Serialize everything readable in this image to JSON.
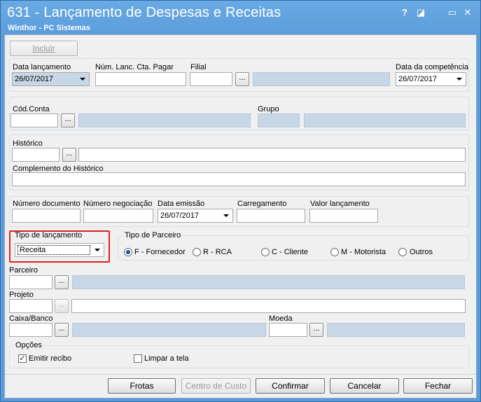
{
  "window": {
    "title": "631 - Lançamento de Despesas e Receitas",
    "subtitle": "Winthor - PC Sistemas",
    "help_label": "?",
    "restore_label": "◪",
    "minimize_label": "▭",
    "close_label": "✕"
  },
  "toolbar": {
    "incluir_label": "Incluir"
  },
  "header_fields": {
    "data_lancamento_label": "Data lançamento",
    "data_lancamento_value": "26/07/2017",
    "num_lanc_label": "Núm. Lanc. Cta. Pagar",
    "num_lanc_value": "",
    "filial_label": "Filial",
    "filial_value": "",
    "data_competencia_label": "Data da competência",
    "data_competencia_value": "26/07/2017"
  },
  "conta": {
    "cod_conta_label": "Cód.Conta",
    "grupo_label": "Grupo"
  },
  "historico": {
    "historico_label": "Histórico",
    "complemento_label": "Complemento do Histórico"
  },
  "documento": {
    "numero_documento_label": "Número documento",
    "numero_negociacao_label": "Número negociação",
    "data_emissao_label": "Data emissão",
    "data_emissao_value": "26/07/2017",
    "carregamento_label": "Carregamento",
    "valor_lancamento_label": "Valor lançamento"
  },
  "tipo_lancamento": {
    "label": "Tipo de lançamento",
    "value": "Receita"
  },
  "tipo_parceiro": {
    "label": "Tipo de Parceiro",
    "options": [
      {
        "label": "F - Fornecedor",
        "selected": true
      },
      {
        "label": "R - RCA",
        "selected": false
      },
      {
        "label": "C - Cliente",
        "selected": false
      },
      {
        "label": "M - Motorista",
        "selected": false
      },
      {
        "label": "Outros",
        "selected": false
      }
    ]
  },
  "parceiro": {
    "label": "Parceiro"
  },
  "projeto": {
    "label": "Projeto"
  },
  "caixa_banco": {
    "label": "Caixa/Banco",
    "moeda_label": "Moeda"
  },
  "opcoes": {
    "label": "Opções",
    "emitir_recibo_label": "Emitir recibo",
    "emitir_recibo_checked": true,
    "limpar_tela_label": "Limpar a tela",
    "limpar_tela_checked": false
  },
  "footer_buttons": {
    "frotas": "Frotas",
    "centro_custo": "Centro de Custo",
    "confirmar": "Confirmar",
    "cancelar": "Cancelar",
    "fechar": "Fechar"
  },
  "colors": {
    "title_bar": "#5b9ddb",
    "readonly_field": "#c7d7e6",
    "highlight_box": "#e02020"
  }
}
